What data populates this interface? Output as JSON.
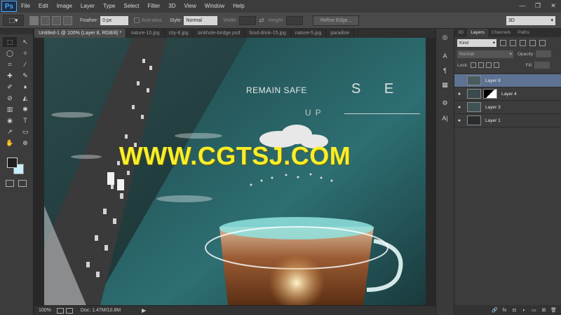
{
  "app": {
    "logo": "Ps"
  },
  "menu": [
    "File",
    "Edit",
    "Image",
    "Layer",
    "Type",
    "Select",
    "Filter",
    "3D",
    "View",
    "Window",
    "Help"
  ],
  "window_controls": [
    "—",
    "❐",
    "✕"
  ],
  "options": {
    "feather_label": "Feather:",
    "feather_value": "0 px",
    "antialias_label": "Anti-alias",
    "style_label": "Style:",
    "style_value": "Normal",
    "width_label": "Width:",
    "height_label": "Height:",
    "swap_glyph": "⇄",
    "refine_label": "Refine Edge...",
    "workspace_value": "3D"
  },
  "doc_tabs": [
    {
      "label": "Untitled-1 @ 100% (Layer 8, RGB/8) *",
      "active": true
    },
    {
      "label": "nature-10.jpg",
      "active": false
    },
    {
      "label": "city-8.jpg",
      "active": false
    },
    {
      "label": "sinkhole-bridge.psd",
      "active": false
    },
    {
      "label": "food-drink-15.jpg",
      "active": false
    },
    {
      "label": "nature-5.jpg",
      "active": false
    },
    {
      "label": "paradise",
      "active": false
    }
  ],
  "canvas": {
    "tagline": "REMAIN SAFE",
    "big_letters": "S E",
    "small_letters": "UP",
    "watermark": "WWW.CGTSJ.COM"
  },
  "status": {
    "zoom": "100%",
    "doc_info": "Doc: 1.47M/10.8M",
    "arrow": "▶"
  },
  "layers_panel": {
    "tabs": [
      {
        "label": "3D",
        "active": false
      },
      {
        "label": "Layers",
        "active": true
      },
      {
        "label": "Channels",
        "active": false
      },
      {
        "label": "Paths",
        "active": false
      }
    ],
    "kind_value": "Kind",
    "blend_value": "Normal",
    "opacity_label": "Opacity:",
    "lock_label": "Lock:",
    "fill_label": "Fill:",
    "layers": [
      {
        "name": "Layer 8",
        "visible": false,
        "selected": true,
        "thumb": "#4b5c60",
        "mask": false
      },
      {
        "name": "Layer 4",
        "visible": true,
        "selected": false,
        "thumb": "#3b4a4c",
        "mask": true
      },
      {
        "name": "Layer 3",
        "visible": true,
        "selected": false,
        "thumb": "#3f5352",
        "mask": false
      },
      {
        "name": "Layer 1",
        "visible": true,
        "selected": false,
        "thumb": "#2a2d2f",
        "mask": false
      }
    ],
    "footer_icons": [
      "🔗",
      "fx",
      "◘",
      "◐",
      "▭",
      "⊞",
      "🗑"
    ]
  },
  "tools": [
    "⬚",
    "↖",
    "◯",
    "✧",
    "⌗",
    "⁄",
    "✚",
    "✎",
    "✐",
    "♦",
    "⊘",
    "◭",
    "▥",
    "✱",
    "◉",
    "⌖",
    "✒",
    "T",
    "↗",
    "▭",
    "✋",
    "⊕"
  ],
  "icon_strip": [
    "◎",
    "A",
    "¶",
    "▦",
    "⚙",
    "A|",
    "⚑",
    "¶"
  ],
  "colors": {
    "accent": "#5e7293",
    "watermark": "#f7ee2a",
    "background_swatch": "#c7f0ff"
  }
}
